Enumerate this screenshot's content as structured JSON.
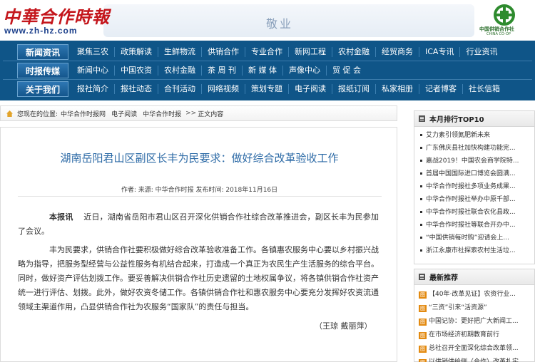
{
  "header": {
    "logo_text": "中華合作時報",
    "logo_url": "www.zh-hz.com",
    "motto": "敬业",
    "coop_name": "中国供销合作社",
    "coop_en": "CHINA CO-OP"
  },
  "nav": {
    "rows": [
      {
        "head": "新闻资讯",
        "items": [
          "聚焦三农",
          "政策解读",
          "生鲜物流",
          "供销合作",
          "专业合作",
          "新网工程",
          "农村金融",
          "经贸商务",
          "ICA专讯",
          "行业资讯"
        ]
      },
      {
        "head": "时报传媒",
        "items": [
          "新闻中心",
          "中国农资",
          "农村金融",
          "茶 周 刊",
          "新 媒 体",
          "声像中心",
          "贸 促 会"
        ]
      },
      {
        "head": "关于我们",
        "items": [
          "报社简介",
          "报社动态",
          "合刊活动",
          "网络视频",
          "策划专题",
          "电子阅读",
          "报纸订阅",
          "私家相册",
          "记者博客",
          "社长信箱"
        ]
      }
    ]
  },
  "breadcrumb": {
    "prefix": "您现在的位置:",
    "links": [
      "中华合作时报网",
      "电子阅读",
      "中华合作时报"
    ],
    "sep": ">>",
    "current": "正文内容"
  },
  "article": {
    "title": "湖南岳阳君山区副区长丰为民要求：做好综合改革验收工作",
    "meta": "作者:   来源: 中华合作时报  发布时间: 2018年11月16日",
    "lead_label": "本报讯",
    "paragraphs": [
      "近日，湖南省岳阳市君山区召开深化供销合作社综合改革推进会，副区长丰为民参加了会议。",
      "丰为民要求，供销合作社要积极做好综合改革验收准备工作。各镇惠农服务中心要以乡村振兴战略为指导，把服务型经营与公益性服务有机结合起来，打造成一个真正为农民生产生活服务的综合平台。同时，做好资产评估划拨工作。要妥善解决供销合作社历史遗留的土地权属争议，将各镇供销合作社资产统一进行评估、划拨。此外，做好农资冬储工作。各镇供销合作社和惠农服务中心要充分发挥好农资流通领域主渠道作用，凸显供销合作社为农服务“国家队”的责任与担当。"
    ],
    "author": "（王琼    戴丽萍）"
  },
  "sidebar": {
    "top10_title": "本月排行TOP10",
    "top10": [
      "艾力素引领氮肥新未来",
      "广东佛庆县社加快构建功能完...",
      "嘉战2019！中国农会商学院特...",
      "首届中国国际进口博览会圆满...",
      "中华合作时报社多项业务成果...",
      "中华合作时报社举办中原千部...",
      "中华合作时报社联合农化县政...",
      "中华合作时报社等联合开办中...",
      "“中国供销每时购”迎请会上...",
      "浙江永康市社探索农村生活垃..."
    ],
    "recom_title": "最新推荐",
    "recom_tag": "图",
    "recom": [
      "【40年·改革见证】农资行业...",
      "“三资”引来“活资源”",
      "中国记协：更好把广大新闻工...",
      "在市场经济初期教育前行",
      "总社召开全面深化综合改革领...",
      "以供销供给侧（合作）改革扎实..."
    ]
  }
}
